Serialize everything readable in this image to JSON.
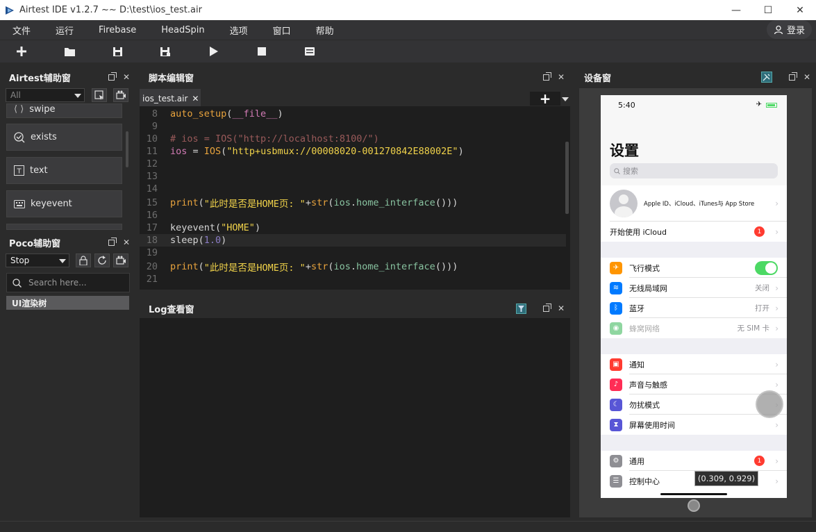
{
  "window": {
    "title": "Airtest IDE v1.2.7 ~~ D:\\test\\ios_test.air",
    "minimize": "—",
    "maximize": "☐",
    "close": "✕"
  },
  "menu": {
    "items": [
      "文件",
      "运行",
      "Firebase",
      "HeadSpin",
      "选项",
      "窗口",
      "帮助"
    ],
    "login_label": "登录"
  },
  "toolbar": {
    "buttons": [
      "new-file",
      "open-folder",
      "save",
      "save-as",
      "run",
      "stop",
      "log"
    ]
  },
  "airtest_panel": {
    "title": "Airtest辅助窗",
    "filter_value": "All",
    "api_buttons": [
      "swipe",
      "exists",
      "text",
      "keyevent"
    ]
  },
  "poco_panel": {
    "title": "Poco辅助窗",
    "mode_value": "Stop",
    "search_placeholder": "Search here...",
    "tree_root": "UI渲染树"
  },
  "editor_panel": {
    "title": "脚本编辑窗",
    "tab_label": "ios_test.air",
    "tab_close": "✕",
    "lines": [
      {
        "n": "8",
        "tokens": [
          [
            "fn",
            "auto_setup"
          ],
          [
            "txt",
            "("
          ],
          [
            "var",
            "__file__"
          ],
          [
            "txt",
            ")"
          ]
        ]
      },
      {
        "n": "9",
        "tokens": []
      },
      {
        "n": "10",
        "tokens": [
          [
            "cmt",
            "# ios = IOS(\"http://localhost:8100/\")"
          ]
        ]
      },
      {
        "n": "11",
        "tokens": [
          [
            "var",
            "ios"
          ],
          [
            "txt",
            " = "
          ],
          [
            "fn",
            "IOS"
          ],
          [
            "txt",
            "("
          ],
          [
            "str",
            "\"http+usbmux://00008020-001270842E88002E\""
          ],
          [
            "txt",
            ")"
          ]
        ]
      },
      {
        "n": "12",
        "tokens": []
      },
      {
        "n": "13",
        "tokens": []
      },
      {
        "n": "14",
        "tokens": []
      },
      {
        "n": "15",
        "tokens": [
          [
            "kw",
            "print"
          ],
          [
            "txt",
            "("
          ],
          [
            "str",
            "\"此时是否是HOME页: \""
          ],
          [
            "txt",
            "+"
          ],
          [
            "fn",
            "str"
          ],
          [
            "txt",
            "("
          ],
          [
            "ios",
            "ios"
          ],
          [
            "txt",
            "."
          ],
          [
            "ios",
            "home_interface"
          ],
          [
            "txt",
            "()))"
          ]
        ]
      },
      {
        "n": "16",
        "tokens": []
      },
      {
        "n": "17",
        "tokens": [
          [
            "txt",
            "keyevent("
          ],
          [
            "str",
            "\"HOME\""
          ],
          [
            "txt",
            ")"
          ]
        ]
      },
      {
        "n": "18",
        "tokens": [
          [
            "txt",
            "sleep("
          ],
          [
            "num",
            "1.0"
          ],
          [
            "txt",
            ")"
          ]
        ]
      },
      {
        "n": "19",
        "tokens": []
      },
      {
        "n": "20",
        "tokens": [
          [
            "kw",
            "print"
          ],
          [
            "txt",
            "("
          ],
          [
            "str",
            "\"此时是否是HOME页: \""
          ],
          [
            "txt",
            "+"
          ],
          [
            "fn",
            "str"
          ],
          [
            "txt",
            "("
          ],
          [
            "ios",
            "ios"
          ],
          [
            "txt",
            "."
          ],
          [
            "ios",
            "home_interface"
          ],
          [
            "txt",
            "()))"
          ]
        ]
      },
      {
        "n": "21",
        "tokens": []
      }
    ],
    "current_line": "18"
  },
  "log_panel": {
    "title": "Log查看窗"
  },
  "device_panel": {
    "title": "设备窗",
    "phone": {
      "time": "5:40",
      "plane": "✈",
      "page_title": "设置",
      "search_placeholder": "搜索",
      "apple_id_text": "Apple ID、iCloud、iTunes与 App Store",
      "icloud_row": "开始使用 iCloud",
      "icloud_badge": "1",
      "rows_group1": [
        {
          "label": "飞行模式",
          "value": "",
          "toggle": true,
          "color": "#ff9500",
          "icon": "✈"
        },
        {
          "label": "无线局域网",
          "value": "关闭",
          "color": "#007aff",
          "icon": "≋"
        },
        {
          "label": "蓝牙",
          "value": "打开",
          "color": "#007aff",
          "icon": "ᛒ"
        },
        {
          "label": "蜂窝网络",
          "value": "无 SIM 卡",
          "color": "#8fd6a0",
          "icon": "◉"
        }
      ],
      "rows_group2": [
        {
          "label": "通知",
          "value": "",
          "color": "#ff3b30",
          "icon": "▣"
        },
        {
          "label": "声音与触感",
          "value": "",
          "color": "#ff2d55",
          "icon": "♪"
        },
        {
          "label": "勿扰模式",
          "value": "",
          "color": "#5856d6",
          "icon": "☾"
        },
        {
          "label": "屏幕使用时间",
          "value": "",
          "color": "#5856d6",
          "icon": "⧗"
        }
      ],
      "rows_group3": [
        {
          "label": "通用",
          "value": "",
          "color": "#8e8e93",
          "icon": "⚙",
          "badge": "1"
        },
        {
          "label": "控制中心",
          "value": "",
          "color": "#8e8e93",
          "icon": "☰"
        }
      ],
      "coord_tooltip": "(0.309, 0.929)"
    }
  },
  "colors": {
    "bg": "#2b2b2b",
    "editor_bg": "#1e1e1e",
    "accent": "#2f6d7a"
  }
}
